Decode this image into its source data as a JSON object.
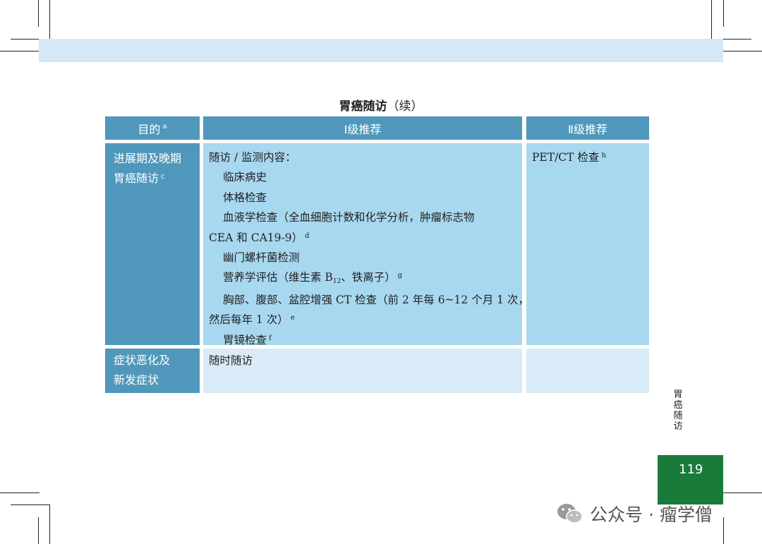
{
  "title": {
    "main": "胃癌随访",
    "suffix": "（续）"
  },
  "table": {
    "headers": {
      "purpose": "目的",
      "purpose_sup": "a",
      "level1": "Ⅰ级推荐",
      "level2": "Ⅱ级推荐"
    },
    "row1": {
      "purpose_line1": "进展期及晚期",
      "purpose_line2": "胃癌随访",
      "purpose_sup": "c",
      "lines": {
        "intro": "随访 / 监测内容：",
        "history": "临床病史",
        "exam": "体格检查",
        "blood_a": "血液学检查（全血细胞计数和化学分析，肿瘤标志物",
        "blood_b": "CEA 和 CA19-9）",
        "blood_sup": "d",
        "hp": "幽门螺杆菌检测",
        "nutrition_a": "营养学评估（维生素 B",
        "nutrition_sub": "12",
        "nutrition_b": "、铁离子）",
        "nutrition_sup": "g",
        "ct_a": "胸部、腹部、盆腔增强 CT 检查（前 2 年每 6~12 个月 1 次，",
        "ct_b": "然后每年 1 次）",
        "ct_sup": "e",
        "endoscopy": "胃镜检查",
        "endoscopy_sup": "f"
      },
      "level2": "PET/CT 检查",
      "level2_sup": "h"
    },
    "row2": {
      "purpose_line1": "症状恶化及",
      "purpose_line2": "新发症状",
      "level1": "随时随访",
      "level2": ""
    }
  },
  "side_label": [
    "胃",
    "癌",
    "随",
    "访"
  ],
  "page_number": "119",
  "watermark": {
    "text": "公众号 · 瘤学僧",
    "icon": "wechat-icon"
  },
  "colors": {
    "header": "#4f98bc",
    "cell_main": "#a8d8f0",
    "cell_light": "#d9ebf6",
    "page_box": "#1a7a3a",
    "band": "#d6e8f5"
  }
}
